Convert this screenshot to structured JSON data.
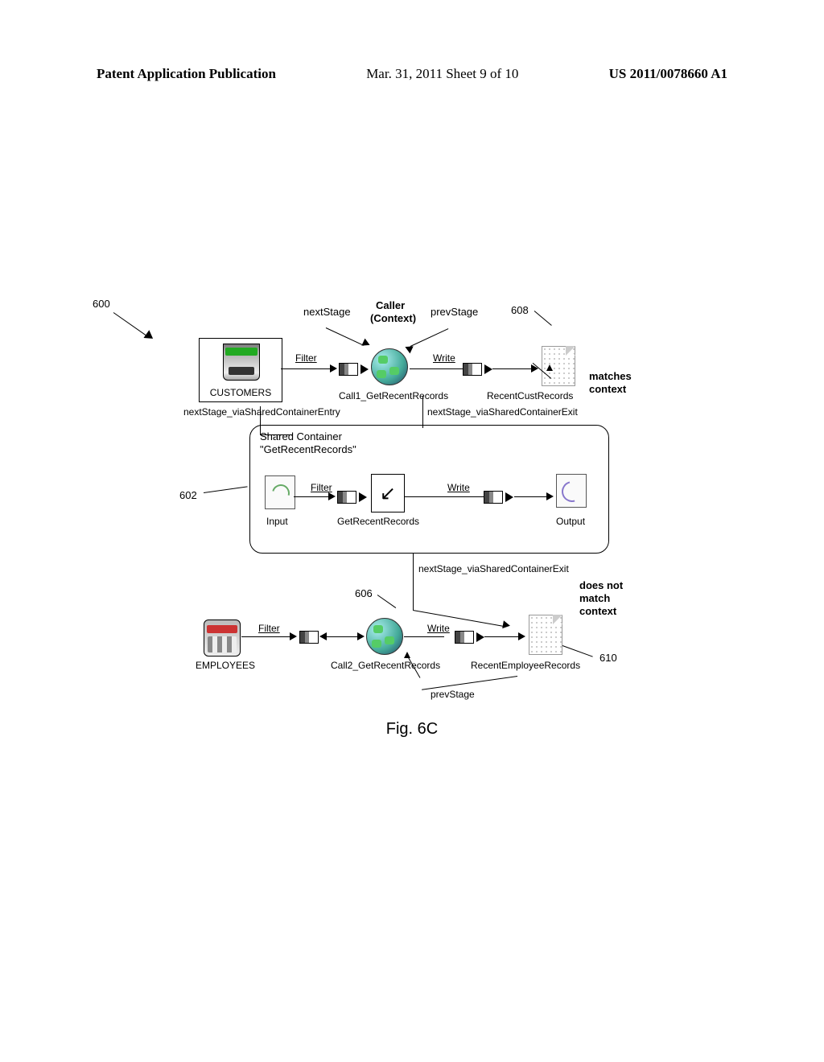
{
  "header": {
    "left": "Patent Application Publication",
    "mid": "Mar. 31, 2011  Sheet 9 of 10",
    "right": "US 2011/0078660 A1"
  },
  "refs": {
    "r600": "600",
    "r602": "602",
    "r606": "606",
    "r608": "608",
    "r610": "610"
  },
  "labels": {
    "nextStage": "nextStage",
    "caller": "Caller",
    "context": "(Context)",
    "prevStage": "prevStage",
    "filter": "Filter",
    "write": "Write",
    "customers": "CUSTOMERS",
    "call1": "Call1_GetRecentRecords",
    "recentCust": "RecentCustRecords",
    "matches": "matches",
    "contextWord": "context",
    "nsViaEntry": "nextStage_viaSharedContainerEntry",
    "nsViaExit": "nextStage_viaSharedContainerExit",
    "sharedTitle1": "Shared Container",
    "sharedTitle2": "\"GetRecentRecords\"",
    "input": "Input",
    "getRec": "GetRecentRecords",
    "output": "Output",
    "doesNot": "does not",
    "match": "match",
    "employees": "EMPLOYEES",
    "call2": "Call2_GetRecentRecords",
    "recentEmp": "RecentEmployeeRecords"
  },
  "figure": "Fig. 6C"
}
